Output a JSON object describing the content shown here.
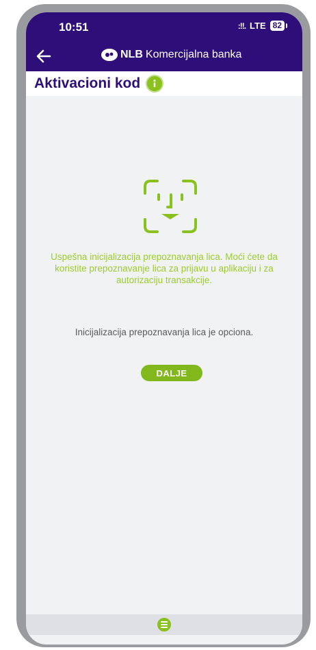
{
  "status_bar": {
    "time": "10:51",
    "signal": ":!!.",
    "network": "LTE",
    "battery": "82"
  },
  "header": {
    "brand_bold": "NLB",
    "brand_rest": "Komercijalna banka"
  },
  "page": {
    "title": "Aktivacioni kod"
  },
  "content": {
    "success_message": "Uspešna inicijalizacija prepoznavanja lica. Moći ćete da koristite prepoznavanje lica za prijavu u aplikaciju i za autorizaciju transakcije.",
    "optional_message": "Inicijalizacija prepoznavanja lica je opciona.",
    "next_button": "DALJE"
  },
  "colors": {
    "header": "#2e0f7a",
    "accent_green": "#8bc11f",
    "success_text": "#9ccc2a"
  },
  "icons": {
    "back": "arrow-left-icon",
    "info": "info-icon",
    "face": "face-id-icon",
    "menu": "menu-icon"
  }
}
